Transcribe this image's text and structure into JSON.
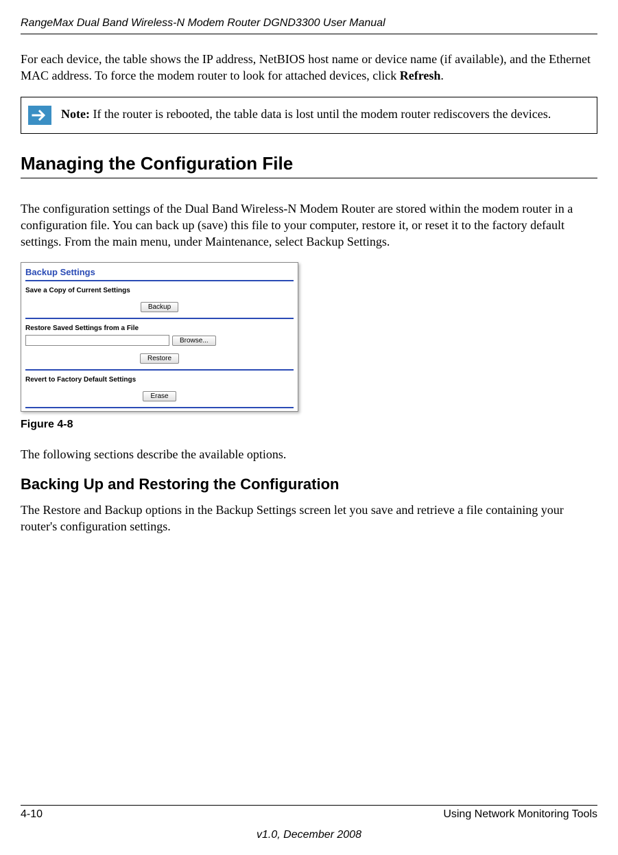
{
  "header": {
    "title": "RangeMax Dual Band Wireless-N Modem Router DGND3300 User Manual"
  },
  "intro": {
    "paragraph": "For each device, the table shows the IP address, NetBIOS host name or device name (if available), and the Ethernet MAC address. To force the modem router to look for attached devices, click ",
    "bold_end": "Refresh",
    "period": "."
  },
  "note": {
    "label": "Note:",
    "text": " If the router is rebooted, the table data is lost until the modem router rediscovers the devices."
  },
  "heading1": "Managing the Configuration File",
  "paragraph2": "The configuration settings of the Dual Band Wireless-N Modem Router are stored within the modem router in a configuration file. You can back up (save) this file to your computer, restore it, or reset it to the factory default settings. From the main menu, under Maintenance, select Backup Settings.",
  "screenshot": {
    "title": "Backup Settings",
    "section1": "Save a Copy of Current Settings",
    "btn_backup": "Backup",
    "section2": "Restore Saved Settings from a File",
    "btn_browse": "Browse...",
    "btn_restore": "Restore",
    "section3": "Revert to Factory Default Settings",
    "btn_erase": "Erase"
  },
  "figure_caption": "Figure 4-8",
  "paragraph3": "The following sections describe the available options.",
  "heading2": "Backing Up and Restoring the Configuration",
  "paragraph4": "The Restore and Backup options in the Backup Settings screen let you save and retrieve a file containing your router's configuration settings.",
  "footer": {
    "page": "4-10",
    "section": "Using Network Monitoring Tools",
    "version": "v1.0, December 2008"
  }
}
